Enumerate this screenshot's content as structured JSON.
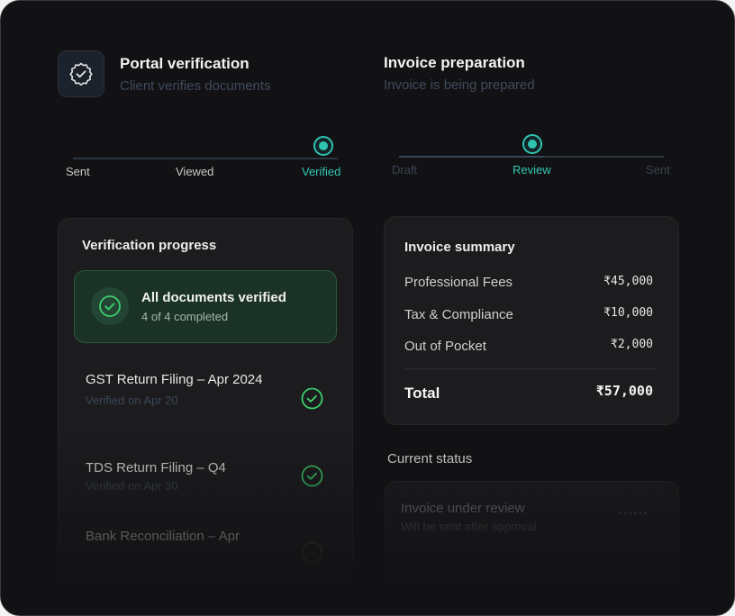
{
  "portal": {
    "title": "Portal verification",
    "subtitle": "Client verifies documents",
    "steps": [
      "Sent",
      "Viewed",
      "Verified"
    ],
    "active_step": "Verified"
  },
  "invoice": {
    "title": "Invoice preparation",
    "subtitle": "Invoice is being prepared",
    "steps": [
      "Draft",
      "Review",
      "Sent"
    ],
    "active_step": "Review"
  },
  "verification": {
    "title": "Verification progress",
    "banner_title": "All documents verified",
    "banner_sub": "4 of 4 completed",
    "documents": [
      {
        "title": "GST Return Filing – Apr 2024",
        "sub": "Verified on Apr 20"
      },
      {
        "title": "TDS Return Filing – Q4",
        "sub": "Verified on Apr 30"
      },
      {
        "title": "Bank Reconciliation – Apr",
        "sub": ""
      }
    ]
  },
  "summary": {
    "title": "Invoice summary",
    "rows": [
      {
        "label": "Professional Fees",
        "value": "₹45,000"
      },
      {
        "label": "Tax & Compliance",
        "value": "₹10,000"
      },
      {
        "label": "Out of Pocket",
        "value": "₹2,000"
      }
    ],
    "total_label": "Total",
    "total_value": "₹57,000"
  },
  "status": {
    "heading": "Current status",
    "title": "Invoice under review",
    "sub": "Will be sent after approval"
  },
  "colors": {
    "accent": "#2fc3b1",
    "success": "#3ccf6e",
    "background": "#121214"
  }
}
